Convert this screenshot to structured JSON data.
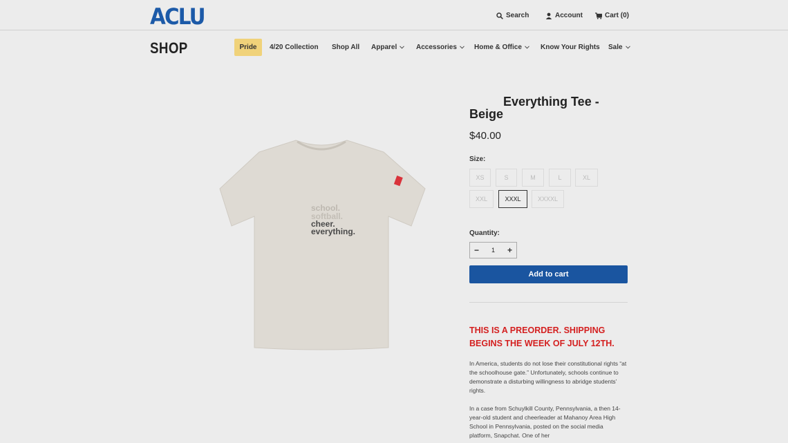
{
  "header": {
    "logo": "ACLU",
    "search_label": "Search",
    "account_label": "Account",
    "cart_label": "Cart (0)"
  },
  "nav": {
    "shop_title": "SHOP",
    "items": [
      {
        "label": "Pride"
      },
      {
        "label": "4/20 Collection"
      },
      {
        "label": "Shop All"
      },
      {
        "label": "Apparel"
      },
      {
        "label": "Accessories"
      },
      {
        "label": "Home & Office"
      },
      {
        "label": "Know Your Rights"
      },
      {
        "label": "Sale"
      }
    ]
  },
  "product": {
    "title_line1": "Everything Tee -",
    "title_line2": "Beige",
    "price": "$40.00",
    "shirt_text": [
      "school.",
      "softball.",
      "cheer.",
      "everything."
    ],
    "size_label": "Size:",
    "sizes": [
      "XS",
      "S",
      "M",
      "L",
      "XL",
      "XXL",
      "XXXL",
      "XXXXL"
    ],
    "selected_size": "XXXL",
    "quantity_label": "Quantity:",
    "quantity": "1",
    "add_to_cart": "Add to cart",
    "preorder_notice": "THIS IS A PREORDER. SHIPPING BEGINS THE WEEK OF JULY 12TH.",
    "description_p1": "In America, students do not lose their constitutional rights “at the schoolhouse gate.” Unfortunately, schools continue to demonstrate a disturbing willingness to abridge students’ rights.",
    "description_p2": "In a case from Schuylkill County, Pennsylvania, a then 14-year-old student and cheerleader at Mahanoy Area High School in Pennsylvania, posted on the social media platform, Snapchat. One of her"
  },
  "colors": {
    "brand_blue": "#1c5aa8",
    "button_blue": "#1a55a0",
    "pride_highlight": "#f0d27a",
    "preorder_red": "#d41f1f"
  }
}
